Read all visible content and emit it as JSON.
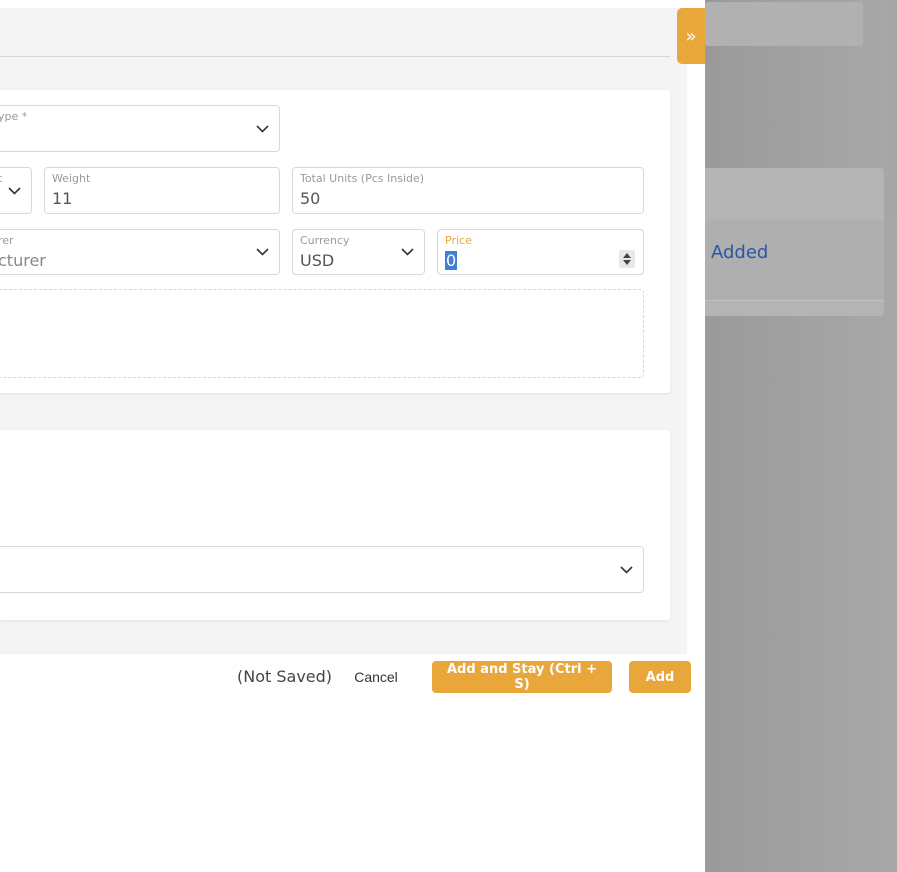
{
  "background": {
    "added_label": "Added"
  },
  "drawer": {
    "collapse_icon": "»",
    "fields": {
      "type": {
        "label": "ype *",
        "value": ""
      },
      "unit": {
        "label": "t",
        "value": ""
      },
      "weight": {
        "label": "Weight",
        "value": "11"
      },
      "total_units": {
        "label": "Total Units (Pcs Inside)",
        "value": "50"
      },
      "manufacturer": {
        "label": "rer",
        "value": "cturer"
      },
      "currency": {
        "label": "Currency",
        "value": "USD"
      },
      "price": {
        "label": "Price",
        "value": "0"
      }
    }
  },
  "footer": {
    "status": "(Not Saved)",
    "cancel_label": "Cancel",
    "add_and_stay_label": "Add and Stay (Ctrl + S)",
    "add_label": "Add"
  },
  "colors": {
    "accent": "#e9a73b",
    "link": "#2a56a8"
  }
}
